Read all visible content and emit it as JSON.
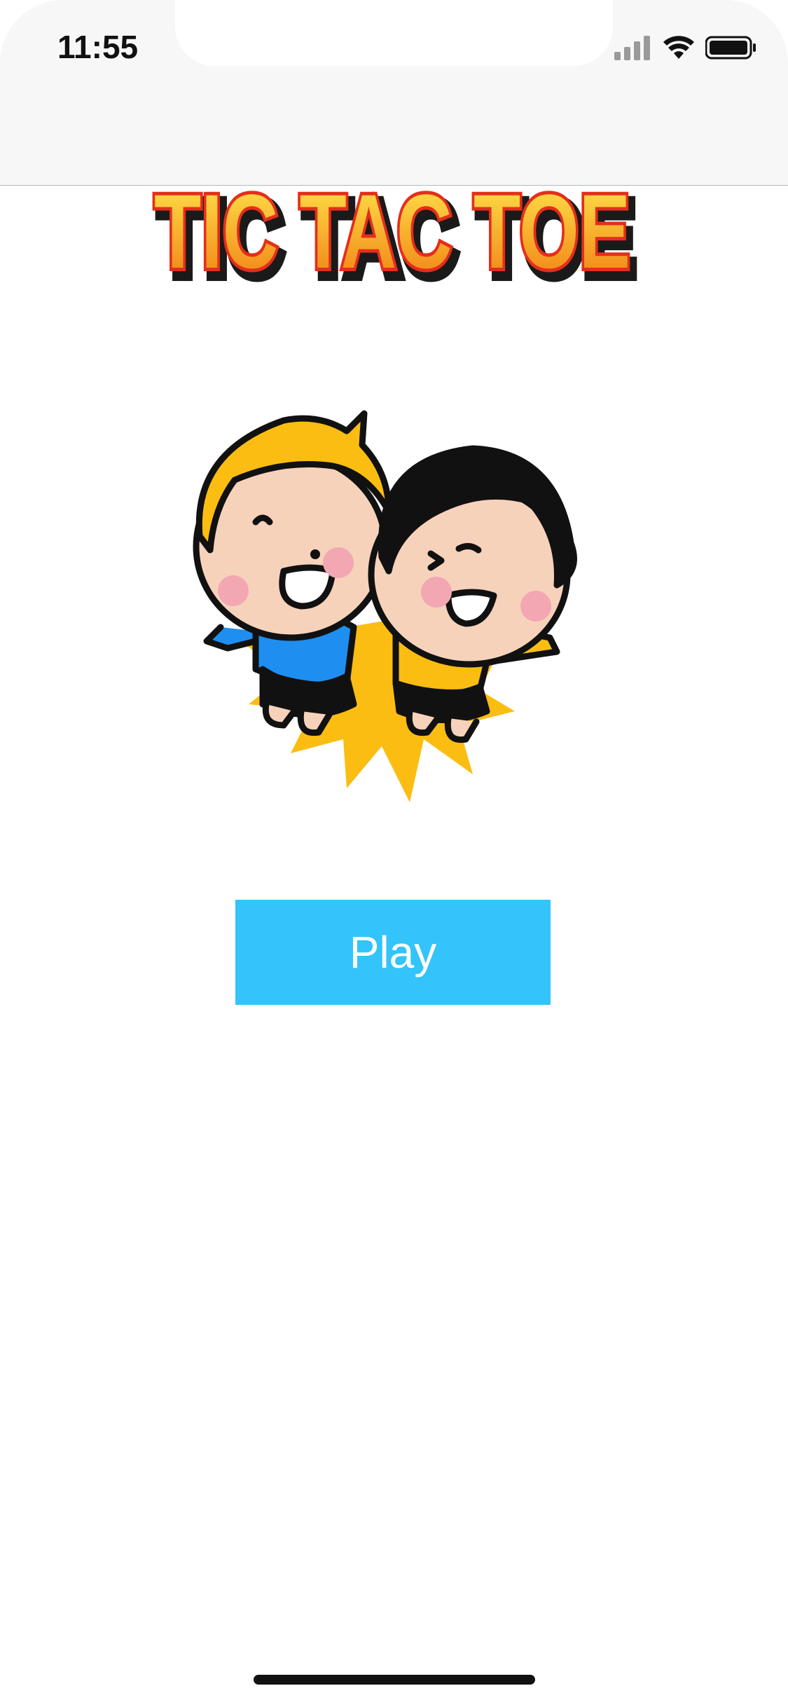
{
  "status_bar": {
    "time": "11:55",
    "signal_icon": "cellular-signal-icon",
    "wifi_icon": "wifi-icon",
    "battery_icon": "battery-icon"
  },
  "logo": {
    "text": "TIC TAC TOE",
    "colors": {
      "fill_top": "#ffe94d",
      "fill_bottom": "#f07c12",
      "outline": "#e52e1b",
      "shadow": "#1a1a1a"
    }
  },
  "hero": {
    "icon": "two-kids-celebrating-illustration"
  },
  "actions": {
    "play_label": "Play",
    "play_color": "#32c4fa"
  },
  "colors": {
    "status_bar_bg": "#f7f7f7",
    "page_bg": "#ffffff"
  }
}
